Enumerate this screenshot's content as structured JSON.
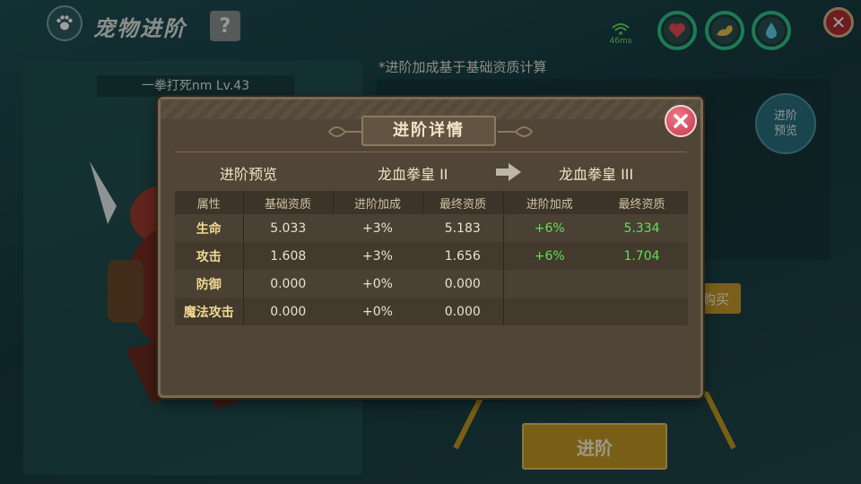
{
  "header": {
    "title": "宠物进阶",
    "help_label": "?",
    "ping": "46ms",
    "close_label": "✕"
  },
  "pet": {
    "name_level": "一拳打死nm Lv.43"
  },
  "info": {
    "note": "*进阶加成基于基础资质计算",
    "preview_button": "进阶\n预览",
    "buy_button": "购买",
    "advance_button": "进阶"
  },
  "modal": {
    "title": "进阶详情",
    "preview_label": "进阶预览",
    "current_name": "龙血拳皇 II",
    "next_name": "龙血拳皇 III",
    "columns": [
      "属性",
      "基础资质",
      "进阶加成",
      "最终资质",
      "进阶加成",
      "最终资质"
    ],
    "rows": [
      {
        "attr": "生命",
        "base": "5.033",
        "bonus": "+3%",
        "final": "5.183",
        "next_bonus": "+6%",
        "next_final": "5.334"
      },
      {
        "attr": "攻击",
        "base": "1.608",
        "bonus": "+3%",
        "final": "1.656",
        "next_bonus": "+6%",
        "next_final": "1.704"
      },
      {
        "attr": "防御",
        "base": "0.000",
        "bonus": "+0%",
        "final": "0.000",
        "next_bonus": "",
        "next_final": ""
      },
      {
        "attr": "魔法攻击",
        "base": "0.000",
        "bonus": "+0%",
        "final": "0.000",
        "next_bonus": "",
        "next_final": ""
      }
    ]
  },
  "colors": {
    "green_value": "#5fe05a",
    "stat_ring": "#2fc68a",
    "close_red": "#c8344e",
    "gold_button": "#c49a24"
  },
  "icons": [
    "paw-icon",
    "wifi-icon",
    "heart-icon",
    "arm-icon",
    "water-drop-icon",
    "close-icon",
    "arrow-right-icon"
  ]
}
